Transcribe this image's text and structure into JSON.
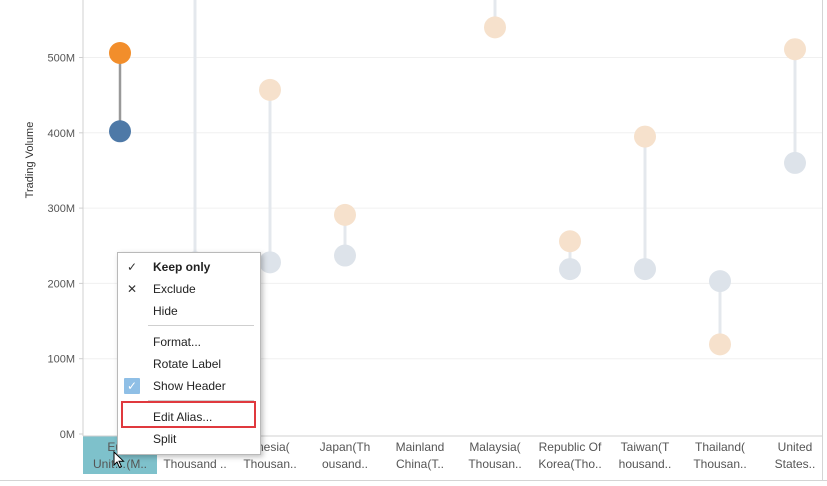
{
  "chart_data": {
    "type": "dumbbell",
    "ylabel": "Trading Volume",
    "ylim": [
      0,
      550
    ],
    "yticks": [
      {
        "value": 0,
        "label": "0M"
      },
      {
        "value": 100,
        "label": "100M"
      },
      {
        "value": 200,
        "label": "200M"
      },
      {
        "value": 300,
        "label": "300M"
      },
      {
        "value": 400,
        "label": "400M"
      },
      {
        "value": 500,
        "label": "500M"
      }
    ],
    "categories": [
      {
        "lines": [
          "Euro",
          "Unit…(M.."
        ],
        "start": 402,
        "end": 506,
        "highlighted": true
      },
      {
        "lines": [
          "",
          "Thousand .."
        ],
        "start": 228,
        "end": 620,
        "highlighted": false
      },
      {
        "lines": [
          "onesia(",
          "Thousan.."
        ],
        "start": 228,
        "end": 457,
        "highlighted": false
      },
      {
        "lines": [
          "Japan(Th",
          "ousand.."
        ],
        "start": 237,
        "end": 291,
        "highlighted": false
      },
      {
        "lines": [
          "Mainland",
          "China(T.."
        ],
        "start": null,
        "end": null,
        "highlighted": false
      },
      {
        "lines": [
          "Malaysia(",
          "Thousan.."
        ],
        "start": 600,
        "end": 540,
        "highlighted": false
      },
      {
        "lines": [
          "Republic Of",
          "Korea(Tho.."
        ],
        "start": 219,
        "end": 256,
        "highlighted": false
      },
      {
        "lines": [
          "Taiwan(T",
          "housand.."
        ],
        "start": 219,
        "end": 395,
        "highlighted": false
      },
      {
        "lines": [
          "Thailand(",
          "Thousan.."
        ],
        "start": 203,
        "end": 119,
        "highlighted": false
      },
      {
        "lines": [
          "United",
          "States.."
        ],
        "start": 360,
        "end": 511,
        "highlighted": false
      }
    ],
    "colors": {
      "start_dot": "#dde3ea",
      "end_dot": "#f6e1cc",
      "connector": "#e4e8ed",
      "start_dot_selected": "#4e79a7",
      "end_dot_selected": "#f28e2b",
      "connector_selected": "#999999",
      "header_selected_bg": "#7ec1cb"
    },
    "grid": true
  },
  "context_menu": {
    "items": [
      {
        "label": "Keep only",
        "mark": "✓",
        "bold": true
      },
      {
        "label": "Exclude",
        "mark": "✕",
        "bold": false
      },
      {
        "label": "Hide",
        "mark": "",
        "bold": false
      },
      {
        "label": "Format...",
        "mark": "",
        "bold": false
      },
      {
        "label": "Rotate Label",
        "mark": "",
        "bold": false
      },
      {
        "label": "Show Header",
        "mark": "✓",
        "bold": false
      },
      {
        "label": "Edit Alias...",
        "mark": "",
        "bold": false
      },
      {
        "label": "Split",
        "mark": "",
        "bold": false
      }
    ],
    "highlighted_item": "Edit Alias..."
  }
}
